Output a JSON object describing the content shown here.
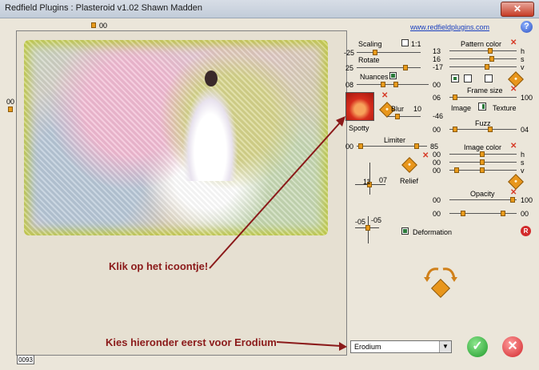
{
  "window": {
    "title": "Redfield Plugins : Plasteroid v1.02   Shawn Madden",
    "close_label": "✕"
  },
  "top_offset_value": "00",
  "left_offset_value": "00",
  "website_link": "www.redfieldplugins.com",
  "help_label": "?",
  "counter_value": "0093",
  "controls": {
    "scaling": {
      "label": "Scaling",
      "ratio_label": "1:1",
      "value": "-25"
    },
    "rotate": {
      "label": "Rotate",
      "value": "25"
    },
    "nuances": {
      "label": "Nuances",
      "value_left": "08",
      "value_right": "00"
    },
    "spotty_label": "Spotty",
    "blur": {
      "label": "Blur",
      "value": "10",
      "value_left": "-46"
    },
    "limiter": {
      "label": "Limiter",
      "value_left": "00",
      "value_right": "85"
    },
    "relief": {
      "label": "Relief",
      "value_x": "11",
      "value_y": "07"
    },
    "shift": {
      "value_x": "-05",
      "value_y": "-05"
    },
    "deformation_label": "Deformation",
    "pattern_color": {
      "label": "Pattern color",
      "h": "13",
      "s": "16",
      "v": "-17",
      "h_label": "h",
      "s_label": "s",
      "v_label": "v"
    },
    "frame_size": {
      "label": "Frame size",
      "value_left": "06",
      "value_right": "100"
    },
    "image_texture": {
      "image_label": "Image",
      "texture_label": "Texture"
    },
    "fuzz": {
      "label": "Fuzz",
      "value_left": "00",
      "value_right": "04"
    },
    "image_color": {
      "label": "Image color",
      "h": "00",
      "s": "00",
      "v": "00",
      "h_label": "h",
      "s_label": "s",
      "v_label": "v"
    },
    "opacity": {
      "label": "Opacity",
      "value_left": "00",
      "value_right": "100",
      "value_left2": "00",
      "value_right2": "00"
    }
  },
  "annotations": {
    "click_icon": "Klik op het icoontje!",
    "choose_below": "Kies hieronder eerst voor Erodium"
  },
  "preset_dropdown": {
    "selected": "Erodium"
  },
  "buttons": {
    "ok": "✓",
    "cancel": "✕",
    "reset": "R"
  }
}
